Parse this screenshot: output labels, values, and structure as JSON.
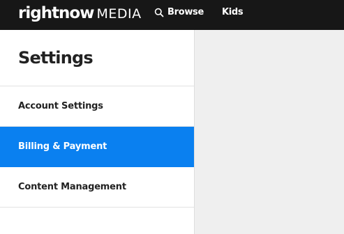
{
  "header": {
    "logo_bold": "rightnow",
    "logo_light": "MEDIA",
    "nav": {
      "browse_label": "Browse",
      "browse_icon": "search-icon",
      "kids_label": "Kids"
    }
  },
  "sidebar": {
    "title": "Settings",
    "items": [
      {
        "label": "Account Settings",
        "active": false
      },
      {
        "label": "Billing & Payment",
        "active": true
      },
      {
        "label": "Content Management",
        "active": false
      }
    ]
  },
  "colors": {
    "topbar": "#171717",
    "accent": "#0a80f0",
    "content_bg": "#efefef"
  }
}
